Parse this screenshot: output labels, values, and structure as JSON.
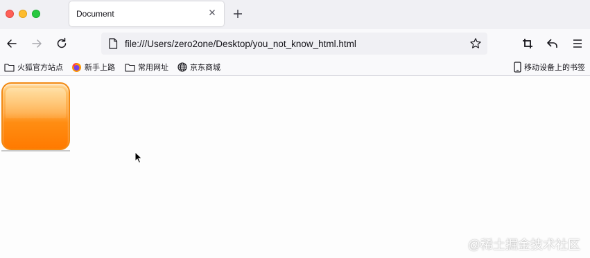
{
  "tab": {
    "title": "Document"
  },
  "urlbar": {
    "url": "file:///Users/zero2one/Desktop/you_not_know_html.html"
  },
  "bookmarks": {
    "items": [
      {
        "label": "火狐官方站点",
        "icon": "folder-icon"
      },
      {
        "label": "新手上路",
        "icon": "firefox-icon"
      },
      {
        "label": "常用网址",
        "icon": "folder-icon"
      },
      {
        "label": "京东商城",
        "icon": "globe-icon"
      }
    ],
    "mobile": {
      "label": "移动设备上的书签",
      "icon": "mobile-icon"
    }
  },
  "content": {
    "watermark": "@稀土掘金技术社区"
  },
  "colors": {
    "accent": "#ff7a00",
    "button_border": "#f28a14"
  }
}
